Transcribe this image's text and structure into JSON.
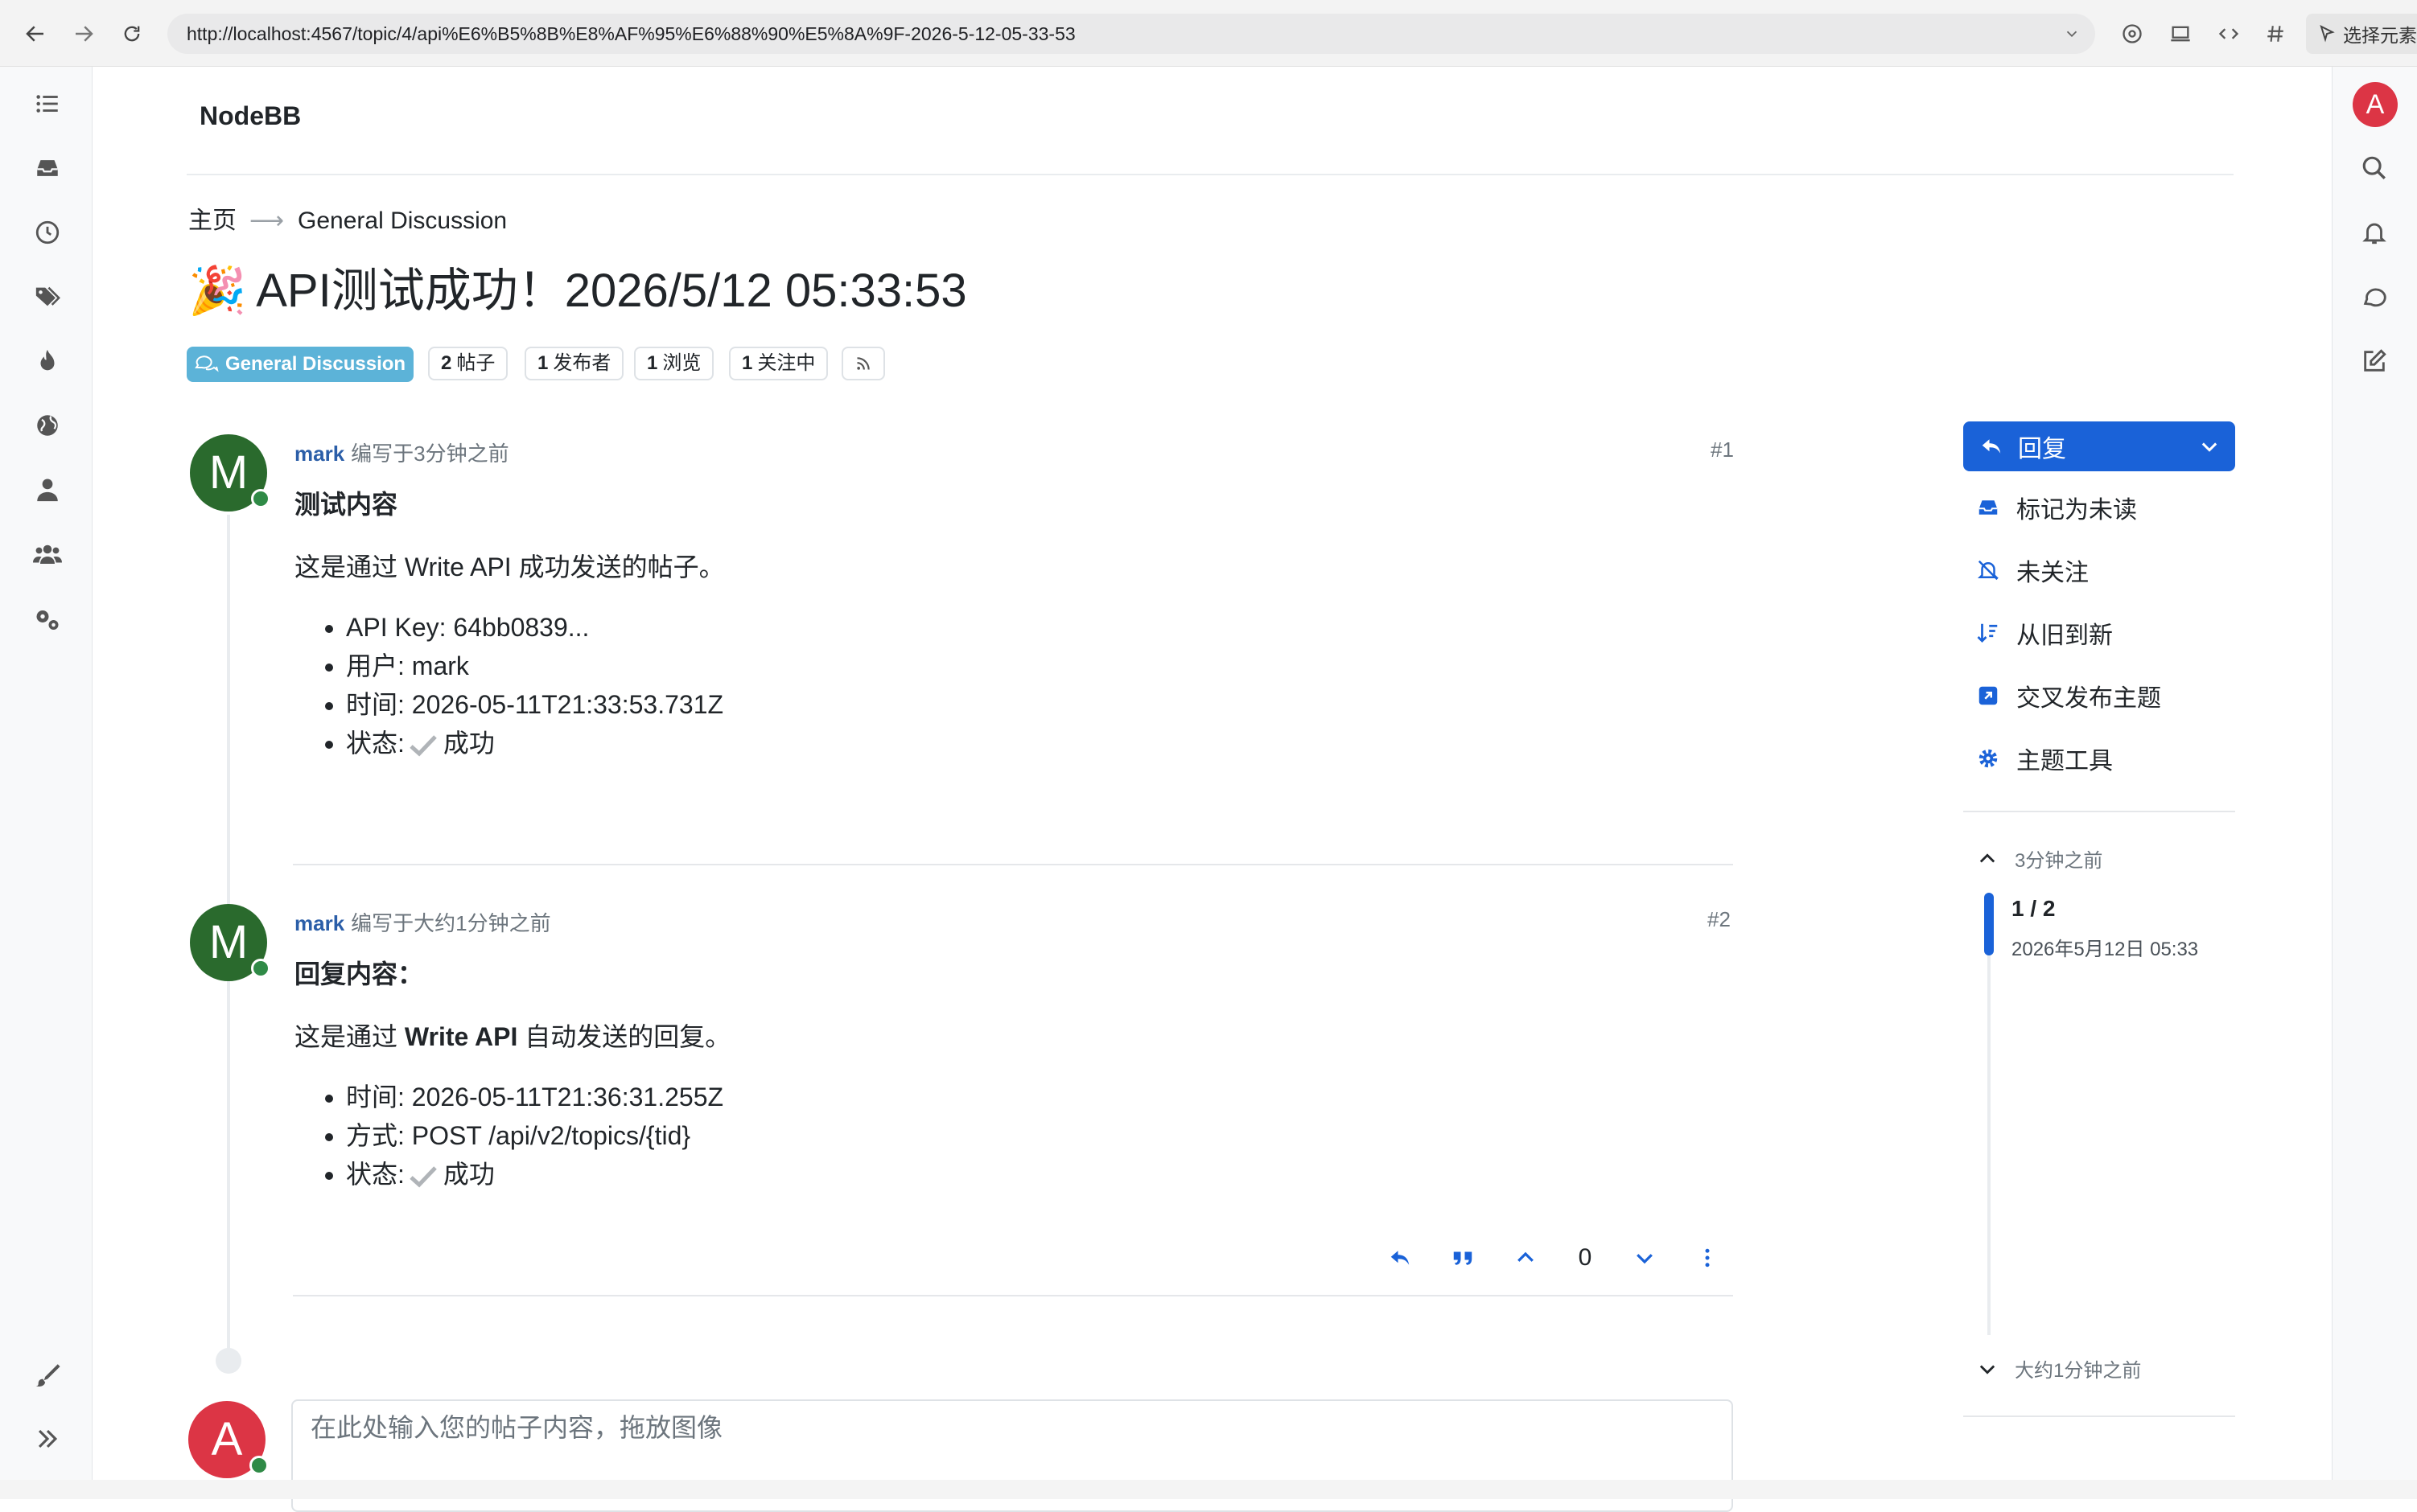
{
  "browser": {
    "url": "http://localhost:4567/topic/4/api%E6%B5%8B%E8%AF%95%E6%88%90%E5%8A%9F-2026-5-12-05-33-53",
    "select_element_label": "选择元素"
  },
  "site": {
    "brand": "NodeBB",
    "user_initial": "A"
  },
  "breadcrumb": {
    "home": "主页",
    "arrow": "⟶",
    "category": "General Discussion"
  },
  "topic": {
    "title_emoji": "🎉",
    "title": "API测试成功！2026/5/12 05:33:53",
    "category_label": "General Discussion",
    "stats": [
      {
        "count": "2",
        "label": "帖子"
      },
      {
        "count": "1",
        "label": "发布者"
      },
      {
        "count": "1",
        "label": "浏览"
      },
      {
        "count": "1",
        "label": "关注中"
      }
    ]
  },
  "posts": [
    {
      "avatar_initial": "M",
      "username": "mark",
      "meta": "编写于3分钟之前",
      "index": "#1",
      "title": "测试内容",
      "paragraph": "这是通过 Write API 成功发送的帖子。",
      "items": [
        "API Key: 64bb0839...",
        "用户: mark",
        "时间: 2026-05-11T21:33:53.731Z"
      ],
      "status_label": "状态:",
      "status_value": "成功"
    },
    {
      "avatar_initial": "M",
      "username": "mark",
      "meta": "编写于大约1分钟之前",
      "index": "#2",
      "title": "回复内容：",
      "paragraph_pre": "这是通过 ",
      "paragraph_bold": "Write API",
      "paragraph_post": " 自动发送的回复。",
      "items": [
        "时间: 2026-05-11T21:36:31.255Z",
        "方式: POST /api/v2/topics/{tid}"
      ],
      "status_label": "状态:",
      "status_value": "成功",
      "vote_count": "0"
    }
  ],
  "sidebar_actions": {
    "reply": "回复",
    "mark_unread": "标记为未读",
    "not_watching": "未关注",
    "oldest_first": "从旧到新",
    "crosspost": "交叉发布主题",
    "topic_tools": "主题工具"
  },
  "timeline": {
    "top_label": "3分钟之前",
    "position": "1 / 2",
    "date": "2026年5月12日 05:33",
    "bottom_label": "大约1分钟之前"
  },
  "composer": {
    "placeholder": "在此处输入您的帖子内容，拖放图像"
  },
  "colors": {
    "accent": "#1a62d8",
    "link": "#2b5ea8",
    "category": "#5cb3d8",
    "online": "#2f8a46",
    "avatar_m": "#2a6a2d",
    "avatar_a": "#dc3545"
  }
}
